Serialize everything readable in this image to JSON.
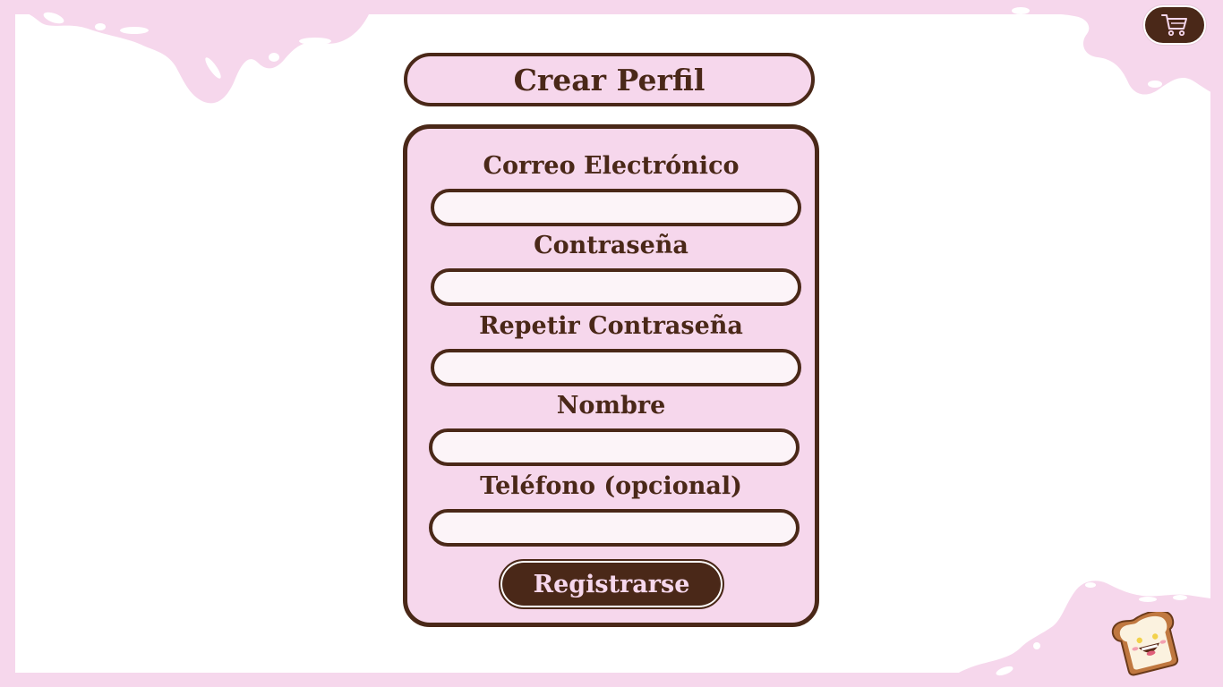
{
  "header": {
    "title": "Crear Perfil"
  },
  "form": {
    "fields": [
      {
        "label": "Correo Electrónico",
        "value": "",
        "placeholder": ""
      },
      {
        "label": "Contraseña",
        "value": "",
        "placeholder": ""
      },
      {
        "label": "Repetir Contraseña",
        "value": "",
        "placeholder": ""
      },
      {
        "label": "Nombre",
        "value": "",
        "placeholder": ""
      },
      {
        "label": "Teléfono (opcional)",
        "value": "",
        "placeholder": ""
      }
    ],
    "submit_label": "Registrarse"
  },
  "icons": {
    "cart": "shopping-cart-icon",
    "mascot": "smiling-toast-icon"
  },
  "colors": {
    "accent_pink": "#f6d7ec",
    "brown": "#4a2818",
    "background": "#ffffff",
    "input_fill": "#fcf4f8"
  }
}
